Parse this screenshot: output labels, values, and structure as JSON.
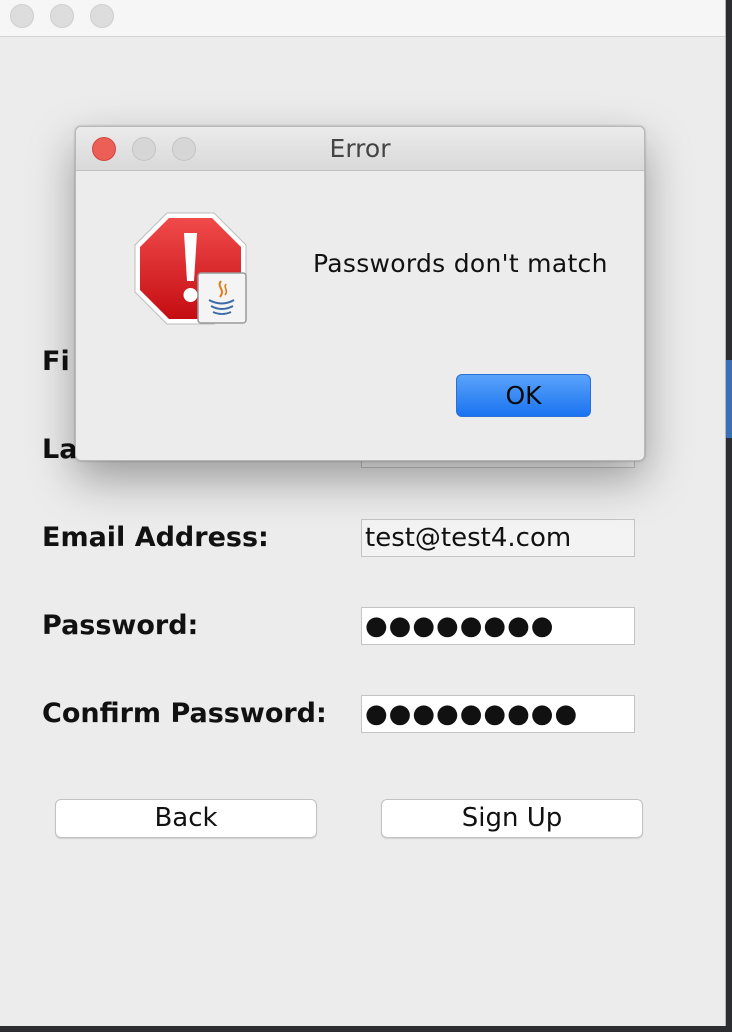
{
  "window": {
    "title": ""
  },
  "form": {
    "first_name_label": "Fi",
    "last_name_label": "La",
    "last_name_value": "",
    "email_label": "Email Address:",
    "email_value": "test@test4.com",
    "password_label": "Password:",
    "password_value": "●●●●●●●●",
    "confirm_label": "Confirm Password:",
    "confirm_value": "●●●●●●●●●"
  },
  "buttons": {
    "back": "Back",
    "sign_up": "Sign Up"
  },
  "dialog": {
    "title": "Error",
    "message": "Passwords don't match",
    "ok_label": "OK",
    "icon": "error-stop-sign-with-java-badge"
  },
  "colors": {
    "accent": "#1a73f0",
    "error_red": "#d0151a",
    "close_light": "#ec5f57"
  }
}
